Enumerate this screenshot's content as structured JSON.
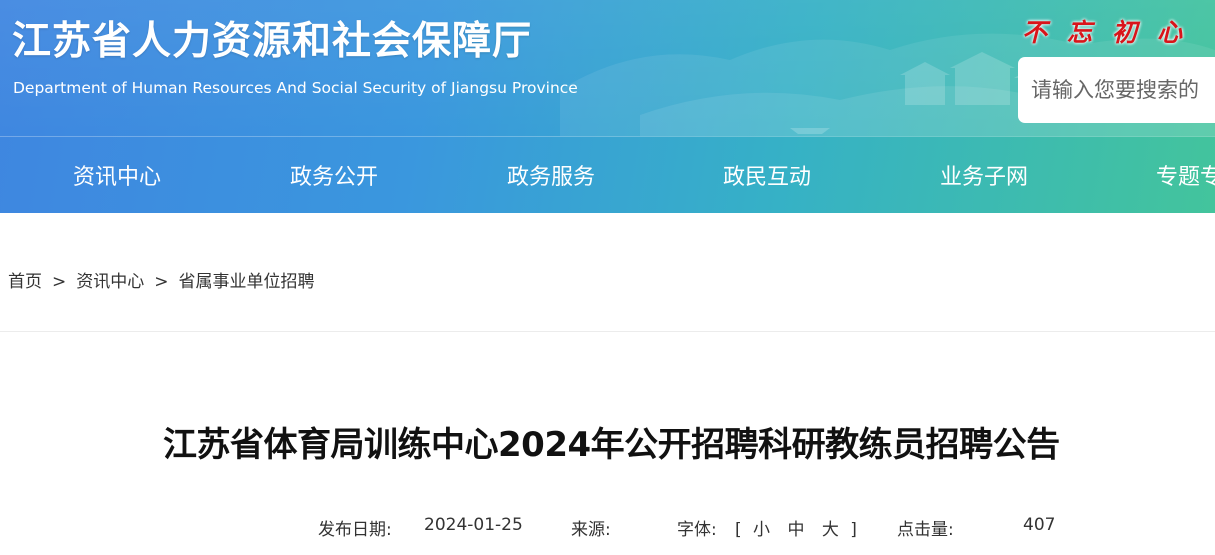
{
  "header": {
    "title": "江苏省人力资源和社会保障厅",
    "subtitle": "Department of Human Resources And Social Security of Jiangsu Province",
    "slogan": "不忘初心",
    "colors": {
      "gradient_start": "#3f86e0",
      "gradient_end": "#43c49c",
      "slogan": "#d9141a"
    }
  },
  "search": {
    "placeholder": "请输入您要搜索的"
  },
  "nav": {
    "items": [
      {
        "label": "资讯中心"
      },
      {
        "label": "政务公开"
      },
      {
        "label": "政务服务"
      },
      {
        "label": "政民互动"
      },
      {
        "label": "业务子网"
      },
      {
        "label": "专题专"
      }
    ]
  },
  "breadcrumb": {
    "items": [
      {
        "label": "首页"
      },
      {
        "label": "资讯中心"
      },
      {
        "label": "省属事业单位招聘"
      }
    ],
    "separator": ">"
  },
  "article": {
    "title": "江苏省体育局训练中心2024年公开招聘科研教练员招聘公告",
    "meta": {
      "date_label": "发布日期:",
      "date": "2024-01-25",
      "source_label": "来源:",
      "font_label": "字体:",
      "bracket_open": "[",
      "font_small": "小",
      "font_medium": "中",
      "font_large": "大",
      "bracket_close": "]",
      "views_label": "点击量:",
      "views": "407"
    }
  }
}
